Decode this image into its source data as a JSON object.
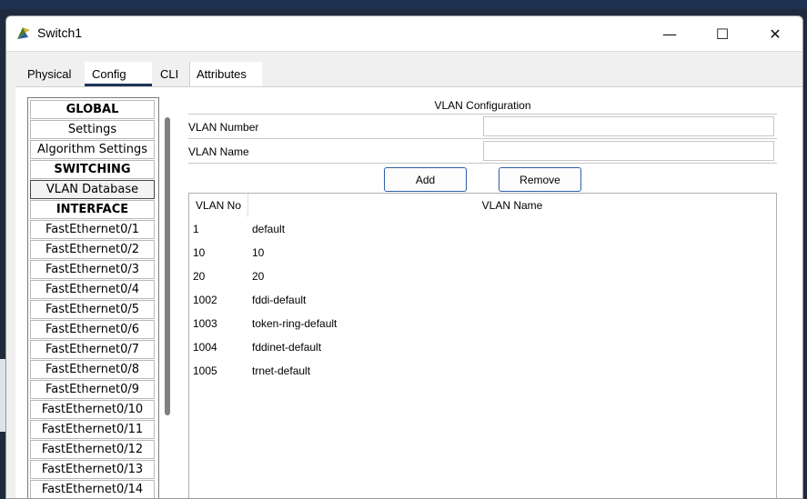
{
  "window": {
    "title": "Switch1"
  },
  "controls": {
    "minimize": "—",
    "maximize": "☐",
    "close": "✕"
  },
  "tabs": [
    {
      "label": "Physical"
    },
    {
      "label": "Config"
    },
    {
      "label": "CLI"
    },
    {
      "label": "Attributes"
    }
  ],
  "sidebar": {
    "items": [
      {
        "label": "GLOBAL",
        "kind": "header"
      },
      {
        "label": "Settings",
        "kind": "item"
      },
      {
        "label": "Algorithm Settings",
        "kind": "item"
      },
      {
        "label": "SWITCHING",
        "kind": "header"
      },
      {
        "label": "VLAN Database",
        "kind": "selected"
      },
      {
        "label": "INTERFACE",
        "kind": "header"
      },
      {
        "label": "FastEthernet0/1",
        "kind": "item"
      },
      {
        "label": "FastEthernet0/2",
        "kind": "item"
      },
      {
        "label": "FastEthernet0/3",
        "kind": "item"
      },
      {
        "label": "FastEthernet0/4",
        "kind": "item"
      },
      {
        "label": "FastEthernet0/5",
        "kind": "item"
      },
      {
        "label": "FastEthernet0/6",
        "kind": "item"
      },
      {
        "label": "FastEthernet0/7",
        "kind": "item"
      },
      {
        "label": "FastEthernet0/8",
        "kind": "item"
      },
      {
        "label": "FastEthernet0/9",
        "kind": "item"
      },
      {
        "label": "FastEthernet0/10",
        "kind": "item"
      },
      {
        "label": "FastEthernet0/11",
        "kind": "item"
      },
      {
        "label": "FastEthernet0/12",
        "kind": "item"
      },
      {
        "label": "FastEthernet0/13",
        "kind": "item"
      },
      {
        "label": "FastEthernet0/14",
        "kind": "item"
      }
    ]
  },
  "vlan_config": {
    "title": "VLAN Configuration",
    "number_label": "VLAN Number",
    "number_value": "",
    "name_label": "VLAN Name",
    "name_value": "",
    "add_label": "Add",
    "remove_label": "Remove",
    "table": {
      "columns": [
        "VLAN No",
        "VLAN Name"
      ],
      "rows": [
        [
          "1",
          "default"
        ],
        [
          "10",
          "10"
        ],
        [
          "20",
          "20"
        ],
        [
          "1002",
          "fddi-default"
        ],
        [
          "1003",
          "token-ring-default"
        ],
        [
          "1004",
          "fddinet-default"
        ],
        [
          "1005",
          "trnet-default"
        ]
      ]
    }
  },
  "colors": {
    "accent": "#1d3457",
    "button_border": "#2e5ea8"
  }
}
